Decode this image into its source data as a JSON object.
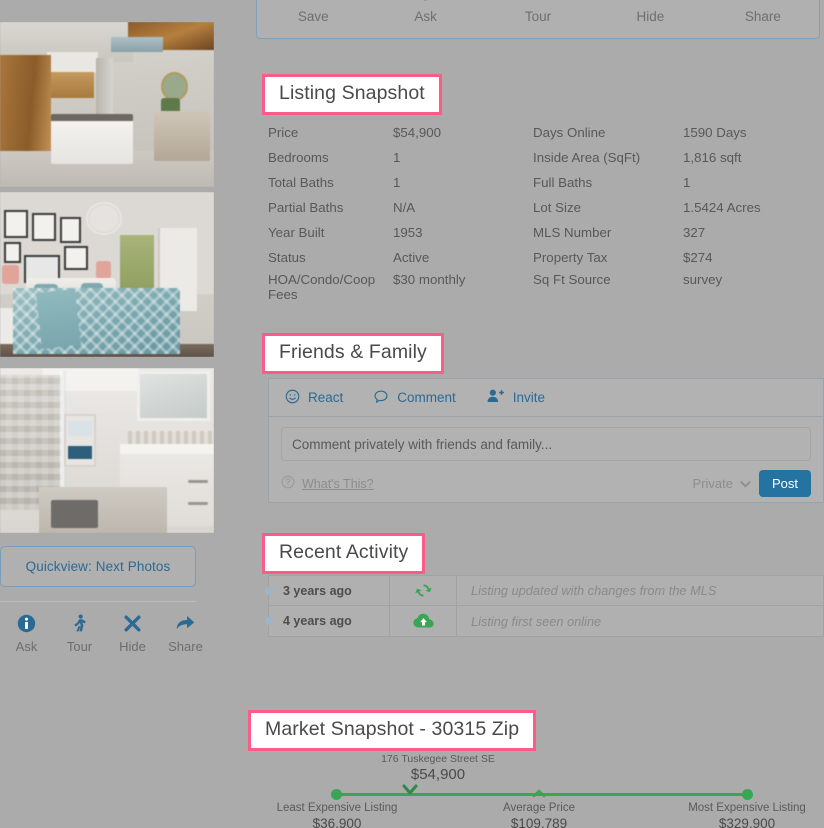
{
  "top_toolbar": {
    "actions": [
      {
        "label": "Save",
        "icon": "bookmark-star-icon"
      },
      {
        "label": "Ask",
        "icon": "info-circle-icon"
      },
      {
        "label": "Tour",
        "icon": "walking-person-icon"
      },
      {
        "label": "Hide",
        "icon": "close-x-icon"
      },
      {
        "label": "Share",
        "icon": "share-arrow-icon"
      }
    ]
  },
  "sidebar": {
    "photos": [
      {
        "alt": "Modern kitchen with wood cabinetry and white island"
      },
      {
        "alt": "Bedroom with teal patterned bedding and framed gallery wall"
      },
      {
        "alt": "White bathroom with glass shower and double vanity"
      }
    ],
    "quickview_label": "Quickview: Next Photos",
    "actions": [
      {
        "label": "Ask",
        "icon": "info-circle-icon"
      },
      {
        "label": "Tour",
        "icon": "walking-person-icon"
      },
      {
        "label": "Hide",
        "icon": "close-x-icon"
      },
      {
        "label": "Share",
        "icon": "share-arrow-icon"
      }
    ]
  },
  "listing_snapshot": {
    "title": "Listing Snapshot",
    "rows": [
      {
        "k1": "Price",
        "v1": "$54,900",
        "k2": "Days Online",
        "v2": "1590 Days"
      },
      {
        "k1": "Bedrooms",
        "v1": "1",
        "k2": "Inside Area (SqFt)",
        "v2": "1,816 sqft"
      },
      {
        "k1": "Total Baths",
        "v1": "1",
        "k2": "Full Baths",
        "v2": "1"
      },
      {
        "k1": "Partial Baths",
        "v1": "N/A",
        "k2": "Lot Size",
        "v2": "1.5424 Acres"
      },
      {
        "k1": "Year Built",
        "v1": "1953",
        "k2": "MLS Number",
        "v2": "327"
      },
      {
        "k1": "Status",
        "v1": "Active",
        "k2": "Property Tax",
        "v2": "$274"
      },
      {
        "k1": "HOA/Condo/Coop Fees",
        "v1": "$30 monthly",
        "k2": "Sq Ft Source",
        "v2": "survey"
      }
    ]
  },
  "friends_family": {
    "title": "Friends & Family",
    "react_label": "React",
    "comment_label": "Comment",
    "invite_label": "Invite",
    "comment_placeholder": "Comment privately with friends and family...",
    "whats_this_label": "What's This?",
    "privacy_value": "Private",
    "post_label": "Post"
  },
  "recent_activity": {
    "title": "Recent Activity",
    "rows": [
      {
        "time": "3 years ago",
        "icon": "refresh-sync-icon",
        "description": "Listing updated with changes from the MLS"
      },
      {
        "time": "4 years ago",
        "icon": "cloud-upload-icon",
        "description": "Listing first seen online"
      }
    ]
  },
  "market_snapshot": {
    "title": "Market Snapshot - 30315 Zip",
    "this_listing_address": "176 Tuskegee Street SE",
    "this_listing_price": "$54,900",
    "least_label": "Least Expensive Listing",
    "least_value": "$36,900",
    "average_label": "Average Price",
    "average_value": "$109,789",
    "most_label": "Most Expensive Listing",
    "most_value": "$329,900"
  },
  "colors": {
    "accent_blue": "#2b6a94",
    "highlight_pink": "#fa5d8a",
    "activity_green": "#3aa655",
    "page_background": "#ababab"
  }
}
